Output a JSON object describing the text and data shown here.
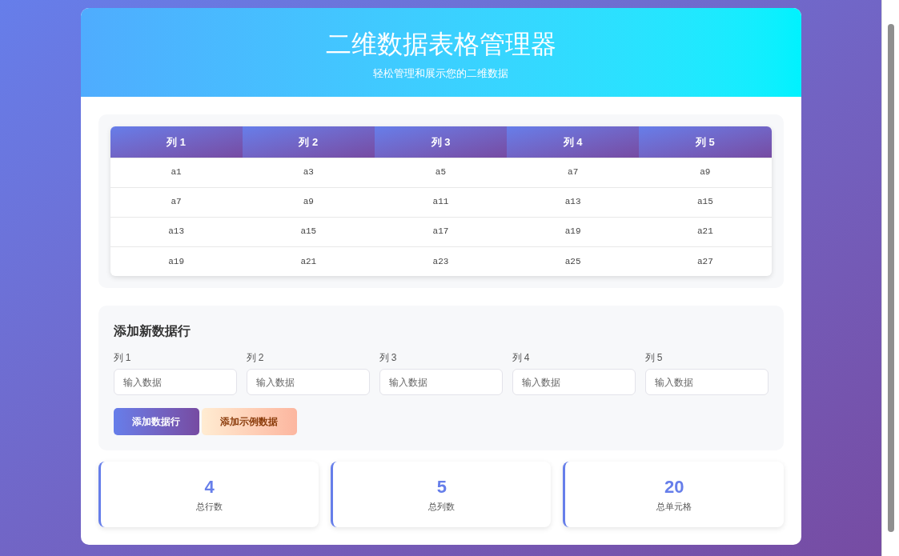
{
  "header": {
    "title": "二维数据表格管理器",
    "subtitle": "轻松管理和展示您的二维数据"
  },
  "table": {
    "columns": [
      "列 1",
      "列 2",
      "列 3",
      "列 4",
      "列 5"
    ],
    "rows": [
      [
        "a1",
        "a3",
        "a5",
        "a7",
        "a9"
      ],
      [
        "a7",
        "a9",
        "a11",
        "a13",
        "a15"
      ],
      [
        "a13",
        "a15",
        "a17",
        "a19",
        "a21"
      ],
      [
        "a19",
        "a21",
        "a23",
        "a25",
        "a27"
      ]
    ]
  },
  "form": {
    "title": "添加新数据行",
    "fields": [
      {
        "label": "列 1",
        "placeholder": "输入数据"
      },
      {
        "label": "列 2",
        "placeholder": "输入数据"
      },
      {
        "label": "列 3",
        "placeholder": "输入数据"
      },
      {
        "label": "列 4",
        "placeholder": "输入数据"
      },
      {
        "label": "列 5",
        "placeholder": "输入数据"
      }
    ],
    "buttons": [
      {
        "label": "添加数据行",
        "kind": "primary"
      },
      {
        "label": "添加示例数据",
        "kind": "secondary"
      }
    ]
  },
  "stats": [
    {
      "value": "4",
      "label": "总行数"
    },
    {
      "value": "5",
      "label": "总列数"
    },
    {
      "value": "20",
      "label": "总单元格"
    }
  ]
}
